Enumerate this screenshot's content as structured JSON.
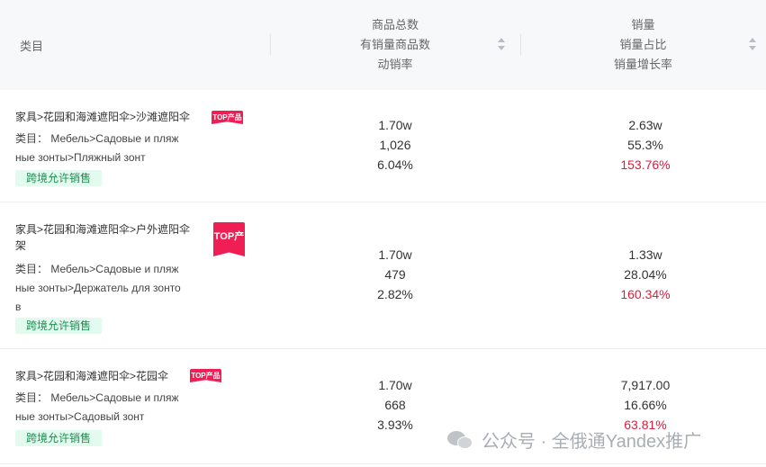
{
  "header": {
    "category": "类目",
    "total_lines": [
      "商品总数",
      "有销量商品数",
      "动销率"
    ],
    "sales_lines": [
      "销量",
      "销量占比",
      "销量增长率"
    ]
  },
  "rows": [
    {
      "path": "家具>花园和海滩遮阳伞>沙滩遮阳伞",
      "tag": "TOP产品",
      "sub_line1": "类目：  Мебель>Садовые и пляж",
      "sub_line2": "ные зонты>Пляжный зонт",
      "sub_line3": "",
      "badge": "跨境允许销售",
      "total": "1.70w",
      "with_sales": "1,026",
      "sell_rate": "6.04%",
      "sales": "2.63w",
      "share": "55.3%",
      "growth": "153.76%"
    },
    {
      "path_line1": "家具>花园和海滩遮阳伞>户外遮阳伞",
      "path_line2": "架",
      "tag": "TOP产品",
      "sub_line1": "类目：  Мебель>Садовые и пляж",
      "sub_line2": "ные зонты>Держатель для зонто",
      "sub_line3": "в",
      "badge": "跨境允许销售",
      "total": "1.70w",
      "with_sales": "479",
      "sell_rate": "2.82%",
      "sales": "1.33w",
      "share": "28.04%",
      "growth": "160.34%"
    },
    {
      "path": "家具>花园和海滩遮阳伞>花园伞",
      "tag": "TOP产品",
      "sub_line1": "类目：  Мебель>Садовые и пляж",
      "sub_line2": "ные зонты>Садовый зонт",
      "sub_line3": "",
      "badge": "跨境允许销售",
      "total": "1.70w",
      "with_sales": "668",
      "sell_rate": "3.93%",
      "sales": "7,917.00",
      "share": "16.66%",
      "growth": "63.81%"
    }
  ],
  "watermark": "公众号 · 全俄通Yandex推广",
  "colors": {
    "tag": "#ef1f55",
    "badge_bg": "#e3faef",
    "badge_text": "#1a8f52",
    "growth": "#d81e3c",
    "header_bg": "#f7f8fa"
  }
}
